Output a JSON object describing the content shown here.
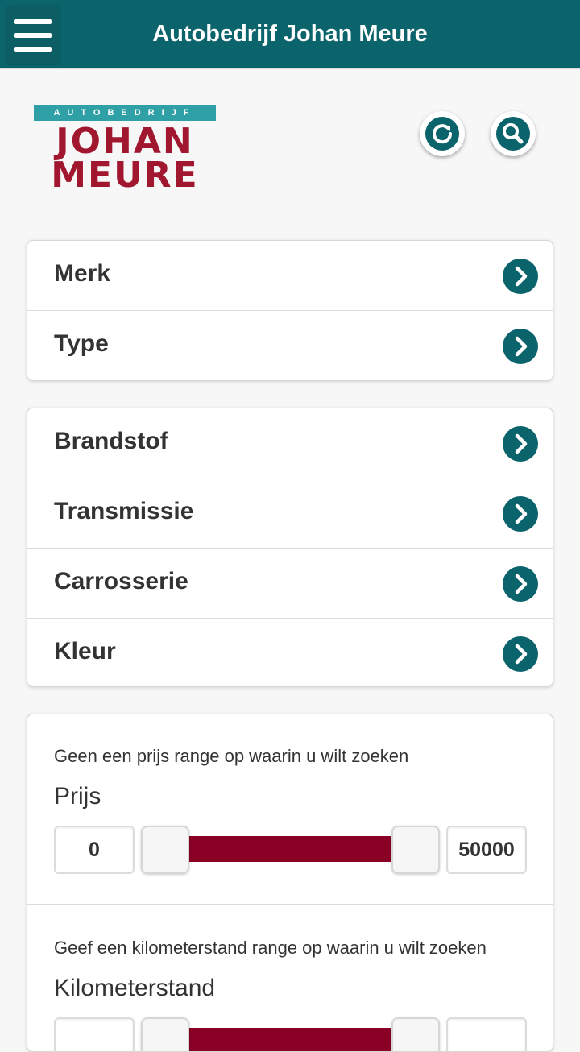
{
  "header": {
    "title": "Autobedrijf Johan Meure",
    "menu_icon": "hamburger-menu-icon"
  },
  "logo": {
    "top_text": "AUTOBEDRIJF",
    "line1": "JOHAN",
    "line2": "MEURE"
  },
  "toolbar": {
    "refresh_icon": "refresh-icon",
    "search_icon": "search-icon"
  },
  "filters_group1": [
    {
      "label": "Merk"
    },
    {
      "label": "Type"
    }
  ],
  "filters_group2": [
    {
      "label": "Brandstof"
    },
    {
      "label": "Transmissie"
    },
    {
      "label": "Carrosserie"
    },
    {
      "label": "Kleur"
    }
  ],
  "price": {
    "hint": "Geen een prijs range op waarin u wilt zoeken",
    "title": "Prijs",
    "min": "0",
    "max": "50000"
  },
  "mileage": {
    "hint": "Geef een kilometerstand range op waarin u wilt zoeken",
    "title": "Kilometerstand"
  },
  "colors": {
    "primary": "#0b636b",
    "accent": "#8b0025",
    "logo_red": "#a0172f"
  }
}
